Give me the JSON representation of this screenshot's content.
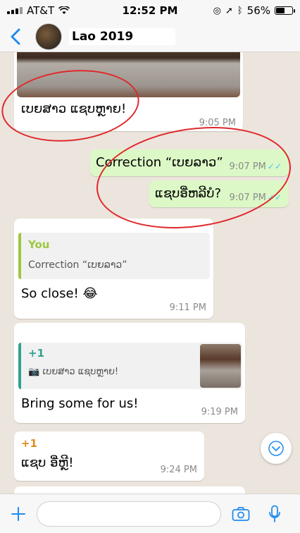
{
  "status_bar": {
    "carrier": "AT&T",
    "time": "12:52 PM",
    "battery": "56%",
    "battery_level": 0.56
  },
  "header": {
    "contact_name": "Lao 2019"
  },
  "messages": [
    {
      "caption": "ເບຍສາວ ແຊບຫຼາຍ!",
      "time": "9:05 PM"
    },
    {
      "text": "Correction “ເບຍລາວ”",
      "time": "9:07 PM",
      "status": "✓✓"
    },
    {
      "text": "ແຊບອີ່ຫລີບໍ?",
      "time": "9:07 PM",
      "status": "✓✓"
    },
    {
      "quote_sender": "You",
      "quote_text": "Correction “ເບຍລາວ”",
      "text": "So close! 😂",
      "time": "9:11 PM"
    },
    {
      "quote_sender": "+1",
      "quote_text": "ເບຍສາວ ແຊບຫຼາຍ!",
      "text": "Bring some for us!",
      "time": "9:19 PM"
    },
    {
      "sender": "+1",
      "text": "ແຊບ ອີ່ຫຼີ!",
      "time": "9:24 PM"
    }
  ],
  "composer": {
    "placeholder": ""
  },
  "colors": {
    "accent": "#1f8cf0",
    "sender_you": "#9cc83d",
    "sender_other": "#e08a1e",
    "annotation": "#e0282c",
    "outgoing": "#dcf8c6"
  }
}
